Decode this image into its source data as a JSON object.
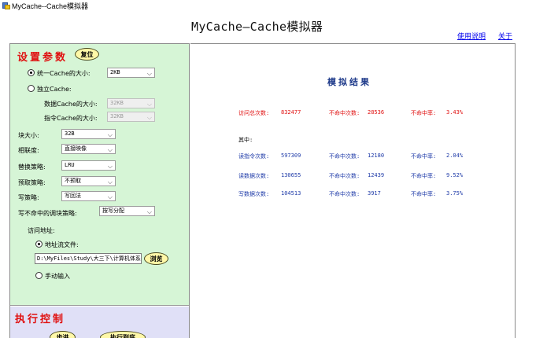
{
  "window": {
    "title": "MyCache--Cache模拟器"
  },
  "header": {
    "title": "MyCache—Cache模拟器",
    "help_link": "使用说明",
    "about_link": "关于"
  },
  "setup": {
    "heading": "设置参数",
    "reset_button": "复位",
    "unified_label": "统一Cache的大小:",
    "unified_value": "2KB",
    "split_label": "独立Cache:",
    "data_cache_label": "数据Cache的大小:",
    "data_cache_value": "32KB",
    "inst_cache_label": "指令Cache的大小:",
    "inst_cache_value": "32KB",
    "block_label": "块大小:",
    "block_value": "32B",
    "assoc_label": "相联度:",
    "assoc_value": "直接映像",
    "replace_label": "替换策略:",
    "replace_value": "LRU",
    "prefetch_label": "预取策略:",
    "prefetch_value": "不预取",
    "write_label": "写策略:",
    "write_value": "写回法",
    "write_miss_label": "写不命中的调块策略:",
    "write_miss_value": "按写分配",
    "address_label": "访问地址:",
    "file_label": "地址流文件:",
    "file_path": "D:\\MyFiles\\Study\\大三下\\计算机体系",
    "browse_button": "浏览",
    "manual_label": "手动输入"
  },
  "exec": {
    "heading": "执行控制",
    "step_button": "步进",
    "run_button": "执行到底"
  },
  "results": {
    "title": "模拟结果",
    "total_label": "访问总次数:",
    "total_value": "832477",
    "total_miss_label": "不命中次数:",
    "total_miss_value": "28536",
    "total_rate_label": "不命中率:",
    "total_rate_value": "3.43%",
    "among_label": "其中:",
    "rows": [
      {
        "label": "读指令次数:",
        "value": "597309",
        "miss_label": "不命中次数:",
        "miss_value": "12180",
        "rate_label": "不命中率:",
        "rate_value": "2.04%"
      },
      {
        "label": "读数据次数:",
        "value": "130655",
        "miss_label": "不命中次数:",
        "miss_value": "12439",
        "rate_label": "不命中率:",
        "rate_value": "9.52%"
      },
      {
        "label": "写数据次数:",
        "value": "104513",
        "miss_label": "不命中次数:",
        "miss_value": "3917",
        "rate_label": "不命中率:",
        "rate_value": "3.75%"
      }
    ]
  },
  "colors": {
    "setup_bg": "#d6f5d6",
    "exec_bg": "#e0e0f7",
    "heading_red": "#e01010",
    "result_blue": "#1e3aa8",
    "button_yellow": "#fff8a8"
  }
}
